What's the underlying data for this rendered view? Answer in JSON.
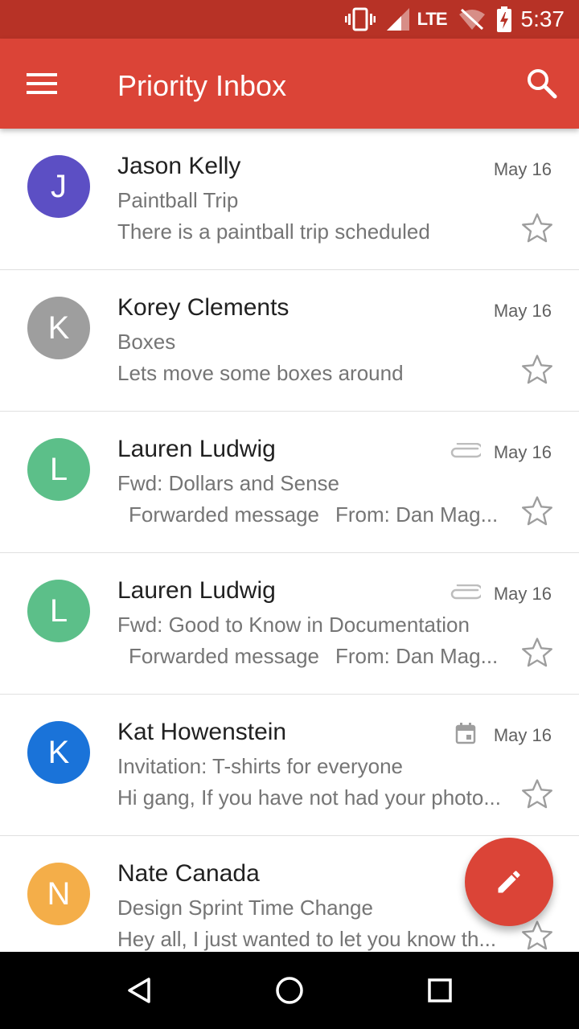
{
  "status_bar": {
    "network": "LTE",
    "time": "5:37",
    "icons": [
      "vibrate-icon",
      "signal-icon",
      "wifi-off-icon",
      "battery-charging-icon"
    ]
  },
  "app_bar": {
    "title": "Priority Inbox",
    "left_icon": "menu-icon",
    "right_icon": "search-icon",
    "color": "#db4437",
    "status_color": "#b73226"
  },
  "emails": [
    {
      "initial": "J",
      "avatar_color": "#5c4fc4",
      "sender": "Jason Kelly",
      "subject": "Paintball Trip",
      "snippet": "There is a paintball trip scheduled",
      "date": "May 16",
      "indicator": "none",
      "starred": false
    },
    {
      "initial": "K",
      "avatar_color": "#9e9e9e",
      "sender": "Korey Clements",
      "subject": "Boxes",
      "snippet": "Lets move some boxes around",
      "date": "May 16",
      "indicator": "none",
      "starred": false
    },
    {
      "initial": "L",
      "avatar_color": "#5cbf89",
      "sender": "Lauren Ludwig",
      "subject": "Fwd: Dollars and Sense",
      "snippet_part1": "Forwarded message",
      "snippet_part2": "From: Dan Mag...",
      "date": "May 16",
      "indicator": "attachment-icon",
      "starred": false
    },
    {
      "initial": "L",
      "avatar_color": "#5cbf89",
      "sender": "Lauren Ludwig",
      "subject": "Fwd: Good to Know in Documentation",
      "snippet_part1": "Forwarded message",
      "snippet_part2": "From: Dan Mag...",
      "date": "May 16",
      "indicator": "attachment-icon",
      "starred": false
    },
    {
      "initial": "K",
      "avatar_color": "#1a73d9",
      "sender": "Kat Howenstein",
      "subject": "Invitation: T-shirts for everyone",
      "snippet": "Hi gang, If you have not had your photo...",
      "date": "May 16",
      "indicator": "calendar-icon",
      "starred": false
    },
    {
      "initial": "N",
      "avatar_color": "#f4ae49",
      "sender": "Nate Canada",
      "subject": "Design Sprint Time Change",
      "snippet": "Hey all, I just wanted to let you know th...",
      "date": "",
      "indicator": "none",
      "starred": false
    }
  ],
  "fab": {
    "icon": "pencil-icon",
    "color": "#db4437"
  },
  "nav_bar": {
    "icons": [
      "back-icon",
      "home-icon",
      "recents-icon"
    ]
  }
}
